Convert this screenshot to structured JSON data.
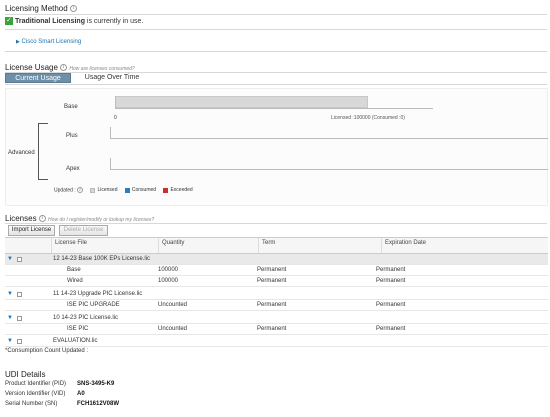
{
  "licensing_method": {
    "title": "Licensing Method",
    "status_bold": "Traditional Licensing",
    "status_rest": " is currently in use.",
    "smart_link": "Cisco Smart Licensing"
  },
  "license_usage": {
    "title": "License Usage",
    "hint": "How are licenses consumed?",
    "tabs": [
      {
        "label": "Current Usage",
        "active": true
      },
      {
        "label": "Usage Over Time",
        "active": false
      }
    ],
    "rows": {
      "base": "Base",
      "advanced": "Advanced",
      "plus": "Plus",
      "apex": "Apex"
    },
    "axis_zero": "0",
    "base_note": "Licensed :100000 (Consumed :0)",
    "updated_label": "Updated :",
    "legend": [
      {
        "label": "Licensed",
        "color": "#d5d5d5"
      },
      {
        "label": "Consumed",
        "color": "#2e7cb8"
      },
      {
        "label": "Exceeded",
        "color": "#c9302c"
      }
    ]
  },
  "licenses": {
    "title": "Licenses",
    "hint": "How do I register/modify or lookup my licenses?",
    "buttons": {
      "import": "Import License",
      "delete": "Delete License"
    },
    "columns": [
      "License File",
      "Quantity",
      "Term",
      "Expiration Date"
    ],
    "rows": [
      {
        "type": "group",
        "file": "12 14-23 Base 100K EPs License.lic",
        "quantity": "",
        "term": "",
        "expiration": ""
      },
      {
        "type": "item",
        "file": "Base",
        "quantity": "100000",
        "term": "Permanent",
        "expiration": "Permanent"
      },
      {
        "type": "item",
        "file": "Wired",
        "quantity": "100000",
        "term": "Permanent",
        "expiration": "Permanent"
      },
      {
        "type": "group2",
        "file": "11 14-23 Upgrade PIC License.lic",
        "quantity": "",
        "term": "",
        "expiration": ""
      },
      {
        "type": "item",
        "file": "ISE PIC UPGRADE",
        "quantity": "Uncounted",
        "term": "Permanent",
        "expiration": "Permanent"
      },
      {
        "type": "group2",
        "file": "10 14-23 PIC License.lic",
        "quantity": "",
        "term": "",
        "expiration": ""
      },
      {
        "type": "item",
        "file": "ISE PIC",
        "quantity": "Uncounted",
        "term": "Permanent",
        "expiration": "Permanent"
      },
      {
        "type": "group2",
        "file": "EVALUATION.lic",
        "quantity": "",
        "term": "",
        "expiration": ""
      }
    ],
    "footnote": "*Consumption Count Updated :"
  },
  "udi": {
    "title": "UDI Details",
    "items": [
      {
        "label": "Product Identifier (PID)",
        "value": "SNS-3495-K9"
      },
      {
        "label": "Version Identifier (VID)",
        "value": "A0"
      },
      {
        "label": "Serial Number (SN)",
        "value": "FCH1612V08W"
      }
    ]
  }
}
